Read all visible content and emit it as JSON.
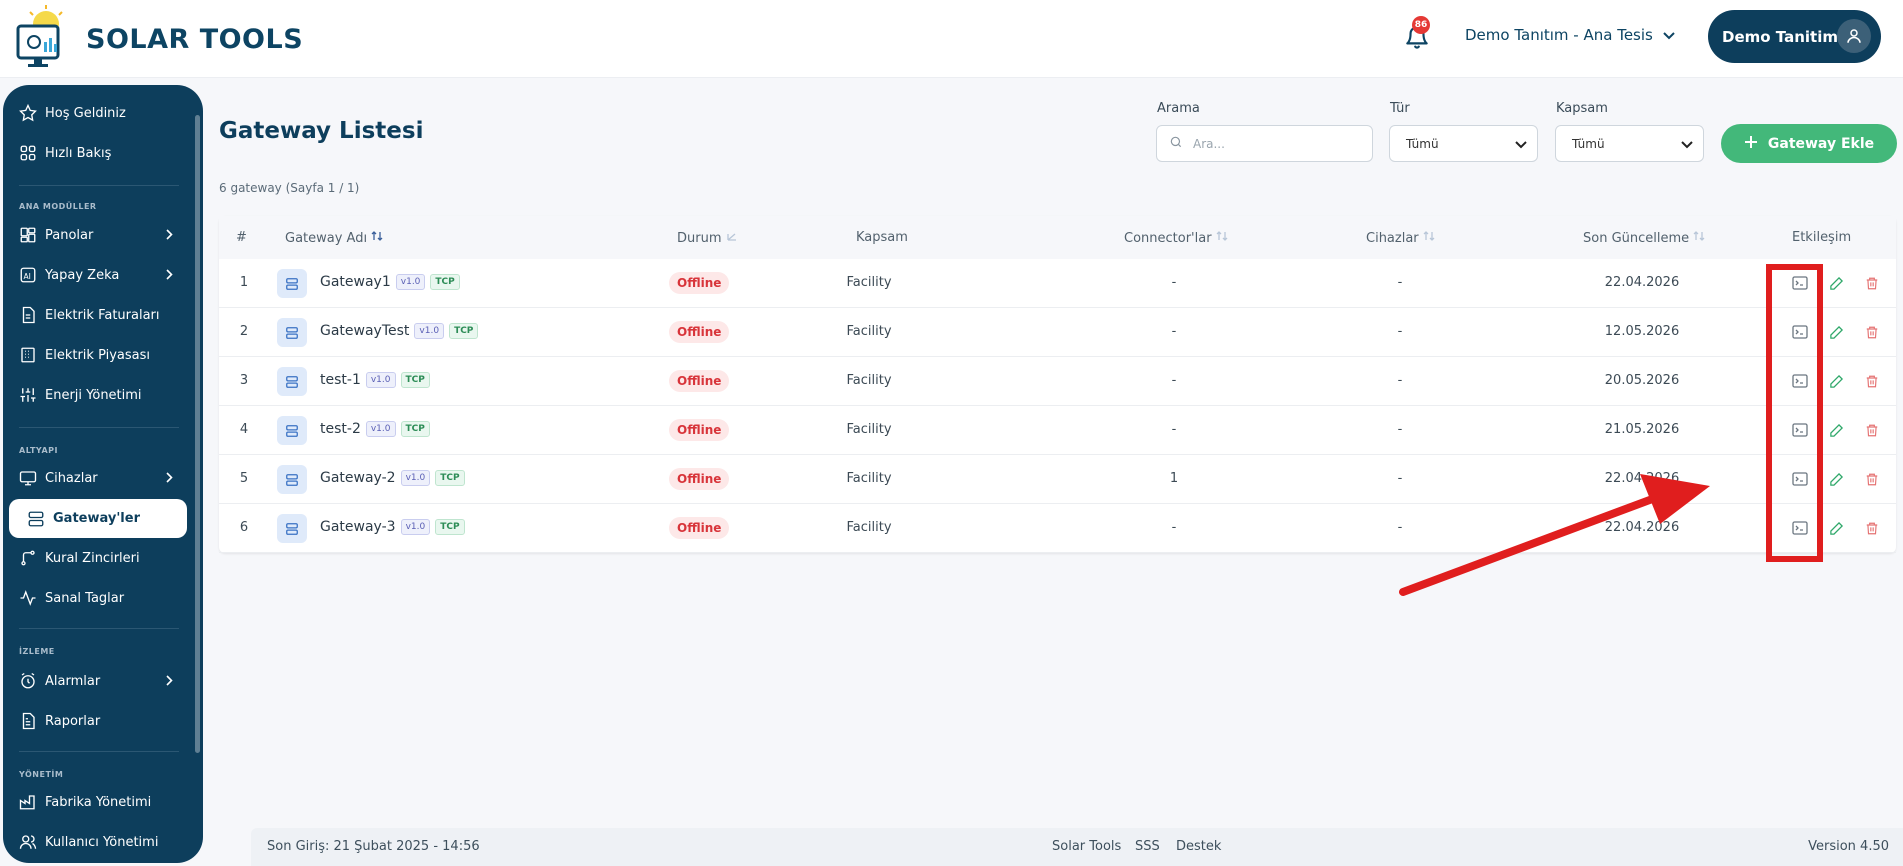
{
  "header": {
    "logo_text": "SOLAR TOOLS",
    "notification_count": "86",
    "facility": "Demo Tanıtım - Ana Tesis",
    "user_name": "Demo Tanitim"
  },
  "sidebar": {
    "top_items": [
      {
        "label": "Hoş Geldiniz",
        "icon": "star-icon"
      },
      {
        "label": "Hızlı Bakış",
        "icon": "grid-icon"
      }
    ],
    "sections": [
      {
        "title": "ANA MODÜLLER",
        "items": [
          {
            "label": "Panolar",
            "icon": "dashboard-icon",
            "chevron": true
          },
          {
            "label": "Yapay Zeka",
            "icon": "ai-icon",
            "chevron": true
          },
          {
            "label": "Elektrik Faturaları",
            "icon": "invoice-icon"
          },
          {
            "label": "Elektrik Piyasası",
            "icon": "market-icon"
          },
          {
            "label": "Enerji Yönetimi",
            "icon": "sliders-icon"
          }
        ]
      },
      {
        "title": "ALTYAPI",
        "items": [
          {
            "label": "Cihazlar",
            "icon": "monitor-icon",
            "chevron": true
          },
          {
            "label": "Gateway'ler",
            "icon": "server-icon",
            "active": true
          },
          {
            "label": "Kural Zincirleri",
            "icon": "git-branch-icon"
          },
          {
            "label": "Sanal Taglar",
            "icon": "activity-icon"
          }
        ]
      },
      {
        "title": "İZLEME",
        "items": [
          {
            "label": "Alarmlar",
            "icon": "alarm-icon",
            "chevron": true
          },
          {
            "label": "Raporlar",
            "icon": "report-icon"
          }
        ]
      },
      {
        "title": "YÖNETİM",
        "items": [
          {
            "label": "Fabrika Yönetimi",
            "icon": "factory-icon"
          },
          {
            "label": "Kullanıcı Yönetimi",
            "icon": "users-icon"
          }
        ]
      }
    ]
  },
  "page": {
    "title": "Gateway Listesi",
    "count_text": "6 gateway (Sayfa 1 / 1)",
    "search_label": "Arama",
    "search_placeholder": "Ara...",
    "type_label": "Tür",
    "type_value": "Tümü",
    "scope_label": "Kapsam",
    "scope_value": "Tümü",
    "add_button": "Gateway Ekle"
  },
  "table": {
    "columns": [
      "#",
      "Gateway Adı",
      "Durum",
      "Kapsam",
      "Connector'lar",
      "Cihazlar",
      "Son Güncelleme",
      "Etkileşim"
    ],
    "rows": [
      {
        "no": "1",
        "name": "Gateway1",
        "version": "v1.0",
        "protocol": "TCP",
        "status": "Offline",
        "scope": "Facility",
        "connectors": "-",
        "devices": "-",
        "updated": "22.04.2026"
      },
      {
        "no": "2",
        "name": "GatewayTest",
        "version": "v1.0",
        "protocol": "TCP",
        "status": "Offline",
        "scope": "Facility",
        "connectors": "-",
        "devices": "-",
        "updated": "12.05.2026"
      },
      {
        "no": "3",
        "name": "test-1",
        "version": "v1.0",
        "protocol": "TCP",
        "status": "Offline",
        "scope": "Facility",
        "connectors": "-",
        "devices": "-",
        "updated": "20.05.2026"
      },
      {
        "no": "4",
        "name": "test-2",
        "version": "v1.0",
        "protocol": "TCP",
        "status": "Offline",
        "scope": "Facility",
        "connectors": "-",
        "devices": "-",
        "updated": "21.05.2026"
      },
      {
        "no": "5",
        "name": "Gateway-2",
        "version": "v1.0",
        "protocol": "TCP",
        "status": "Offline",
        "scope": "Facility",
        "connectors": "1",
        "devices": "-",
        "updated": "22.04.2026"
      },
      {
        "no": "6",
        "name": "Gateway-3",
        "version": "v1.0",
        "protocol": "TCP",
        "status": "Offline",
        "scope": "Facility",
        "connectors": "-",
        "devices": "-",
        "updated": "22.04.2026"
      }
    ]
  },
  "footer": {
    "last_login": "Son Giriş: 21 Şubat 2025 - 14:56",
    "links": [
      "Solar Tools",
      "SSS",
      "Destek"
    ],
    "version": "Version 4.50"
  },
  "colors": {
    "primary": "#0d3e5c",
    "accent_green": "#43b87a",
    "offline_red": "#d8343a",
    "highlight_red": "#e01e1e"
  }
}
